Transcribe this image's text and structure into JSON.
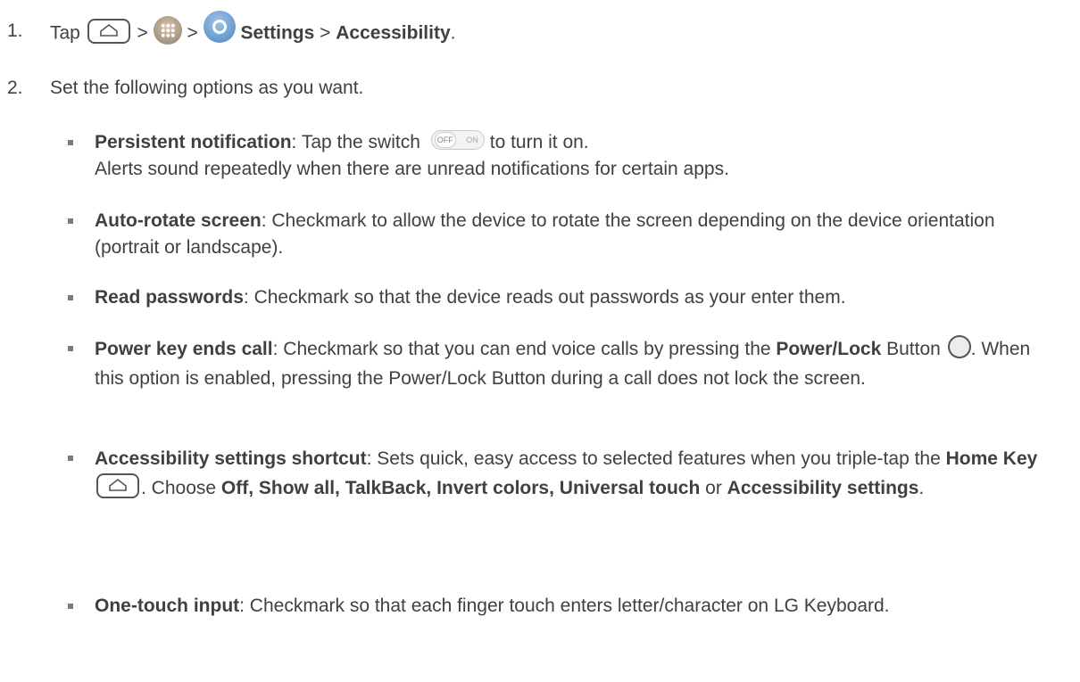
{
  "steps": [
    {
      "num": "1.",
      "tap": "Tap",
      "sep": ">",
      "settings": "Settings",
      "accessibility": "Accessibility",
      "end": "."
    },
    {
      "num": "2.",
      "text": "Set the following options as you want."
    }
  ],
  "icons": {
    "home": "home-key-icon",
    "apps": "apps-icon",
    "settings": "settings-gear-icon",
    "toggle": "off-on-switch-icon",
    "power": "power-lock-button-icon"
  },
  "toggle": {
    "off": "OFF",
    "on": "ON"
  },
  "bullets": {
    "persistent": {
      "title": "Persistent notification",
      "text1": ": Tap the switch",
      "text2": "to turn it on.",
      "line2": "Alerts sound repeatedly when there are unread notifications for certain apps."
    },
    "autorotate": {
      "title": "Auto-rotate screen",
      "text": ": Checkmark to allow the device to rotate the screen depending on the device orientation (portrait or landscape)."
    },
    "readpw": {
      "title": "Read passwords",
      "text": ": Checkmark so that the device reads out passwords as your enter them."
    },
    "power": {
      "title": "Power key ends call",
      "text1": ": Checkmark so that you can end voice calls by pressing the",
      "bold2": "Power/Lock",
      "text2": " Button",
      "text3": ". When this option is enabled, pressing the Power/Lock Button during a call does not lock the screen."
    },
    "shortcut": {
      "title": "Accessibility settings shortcut",
      "text1": ": Sets quick, easy access to selected features when you triple-tap the ",
      "bold2": "Home Key",
      "text2": ". Choose ",
      "bold3": "Off, Show all, TalkBack, Invert colors, Universal touch",
      "text3": " or ",
      "bold4": "Accessibility settings",
      "text4": "."
    },
    "onetouch": {
      "title": "One-touch input",
      "text": ": Checkmark so that each finger touch enters letter/character on LG Keyboard."
    }
  }
}
